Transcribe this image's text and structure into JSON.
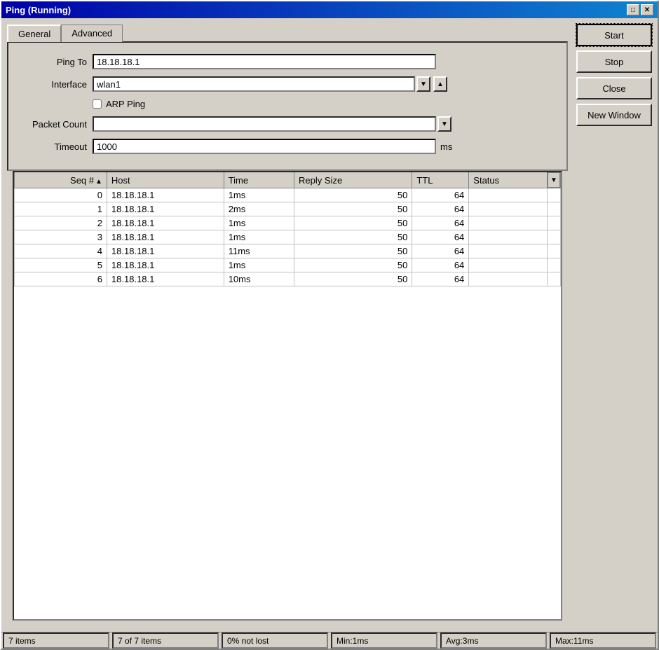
{
  "window": {
    "title": "Ping (Running)",
    "titlebar_buttons": [
      "maximize-icon",
      "close-icon"
    ]
  },
  "tabs": [
    {
      "label": "General",
      "active": true
    },
    {
      "label": "Advanced",
      "active": false
    }
  ],
  "form": {
    "ping_to_label": "Ping To",
    "ping_to_value": "18.18.18.1",
    "interface_label": "Interface",
    "interface_value": "wlan1",
    "arp_ping_label": "ARP Ping",
    "arp_ping_checked": false,
    "packet_count_label": "Packet Count",
    "packet_count_value": "",
    "timeout_label": "Timeout",
    "timeout_value": "1000",
    "timeout_unit": "ms"
  },
  "buttons": {
    "start": "Start",
    "stop": "Stop",
    "close": "Close",
    "new_window": "New Window"
  },
  "table": {
    "columns": [
      "Seq #",
      "Host",
      "Time",
      "Reply Size",
      "TTL",
      "Status"
    ],
    "rows": [
      {
        "seq": 0,
        "host": "18.18.18.1",
        "time": "1ms",
        "reply_size": 50,
        "ttl": 64,
        "status": ""
      },
      {
        "seq": 1,
        "host": "18.18.18.1",
        "time": "2ms",
        "reply_size": 50,
        "ttl": 64,
        "status": ""
      },
      {
        "seq": 2,
        "host": "18.18.18.1",
        "time": "1ms",
        "reply_size": 50,
        "ttl": 64,
        "status": ""
      },
      {
        "seq": 3,
        "host": "18.18.18.1",
        "time": "1ms",
        "reply_size": 50,
        "ttl": 64,
        "status": ""
      },
      {
        "seq": 4,
        "host": "18.18.18.1",
        "time": "11ms",
        "reply_size": 50,
        "ttl": 64,
        "status": ""
      },
      {
        "seq": 5,
        "host": "18.18.18.1",
        "time": "1ms",
        "reply_size": 50,
        "ttl": 64,
        "status": ""
      },
      {
        "seq": 6,
        "host": "18.18.18.1",
        "time": "10ms",
        "reply_size": 50,
        "ttl": 64,
        "status": ""
      }
    ]
  },
  "status_bar": {
    "items": [
      "7 items",
      "7 of 7 items",
      "0% not lost",
      "Min:1ms",
      "Avg:3ms",
      "Max:11ms"
    ]
  }
}
